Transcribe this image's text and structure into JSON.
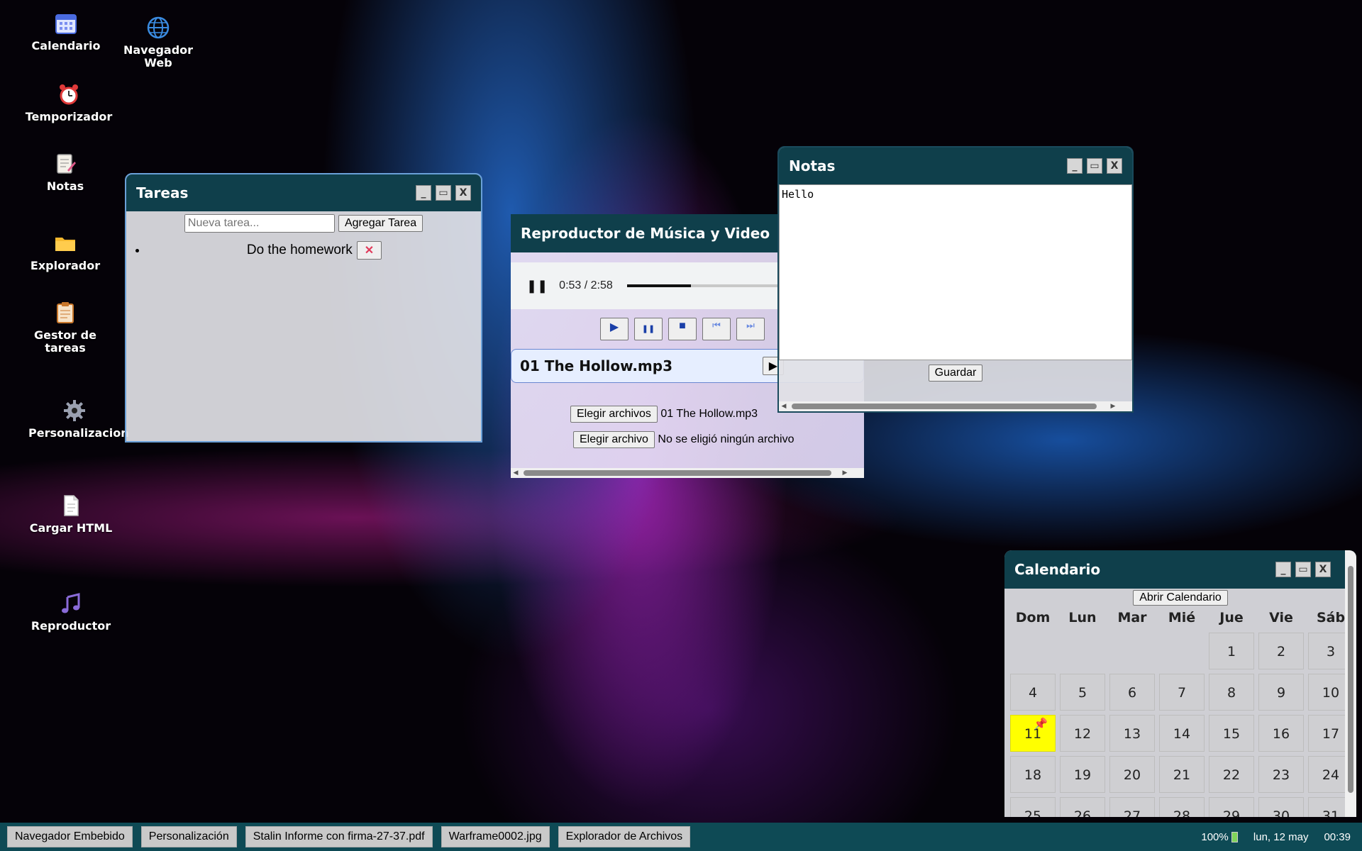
{
  "desktop_icons": [
    {
      "label": "Calendario",
      "icon": "calendar-icon"
    },
    {
      "label": "Navegador Web",
      "icon": "globe-icon"
    },
    {
      "label": "Temporizador",
      "icon": "alarm-clock-icon"
    },
    {
      "label": "Notas",
      "icon": "notepad-icon"
    },
    {
      "label": "Explorador",
      "icon": "folder-icon"
    },
    {
      "label": "Gestor de tareas",
      "icon": "clipboard-icon"
    },
    {
      "label": "Personalizacion",
      "icon": "gear-icon"
    },
    {
      "label": "Cargar HTML",
      "icon": "document-icon"
    },
    {
      "label": "Reproductor",
      "icon": "music-note-icon"
    }
  ],
  "tareas": {
    "title": "Tareas",
    "input_placeholder": "Nueva tarea...",
    "add_label": "Agregar Tarea",
    "items": [
      {
        "text": "Do the homework",
        "delete_glyph": "✕"
      }
    ]
  },
  "player": {
    "title": "Reproductor de Música y Video",
    "current_time": "0:53",
    "duration": "2:58",
    "time_display": "0:53 / 2:58",
    "progress": 0.3,
    "track": "01 The Hollow.mp3",
    "choose_files_label": "Elegir archivos",
    "chosen_files": "01 The Hollow.mp3",
    "choose_file_label": "Elegir archivo",
    "no_file": "No se eligió ningún archivo"
  },
  "notas": {
    "title": "Notas",
    "content": "Hello",
    "save_label": "Guardar"
  },
  "calendario": {
    "title": "Calendario",
    "open_label": "Abrir Calendario",
    "weekdays": [
      "Dom",
      "Lun",
      "Mar",
      "Mié",
      "Jue",
      "Vie",
      "Sáb"
    ],
    "today": 11,
    "leading_blanks": 4,
    "days_shown": 31
  },
  "taskbar": {
    "items": [
      "Navegador Embebido",
      "Personalización",
      "Stalin Informe con firma-27-37.pdf",
      "Warframe0002.jpg",
      "Explorador de Archivos"
    ],
    "battery": "100%",
    "date": "lun, 12 may",
    "time": "00:39"
  },
  "window_buttons": {
    "minimize": "_",
    "maximize": "▭",
    "close": "X"
  },
  "colors": {
    "titlebar": "#0f3f4b",
    "taskbar": "#0e4a55",
    "today": "#ffff00",
    "accent": "#1a3fa8"
  }
}
